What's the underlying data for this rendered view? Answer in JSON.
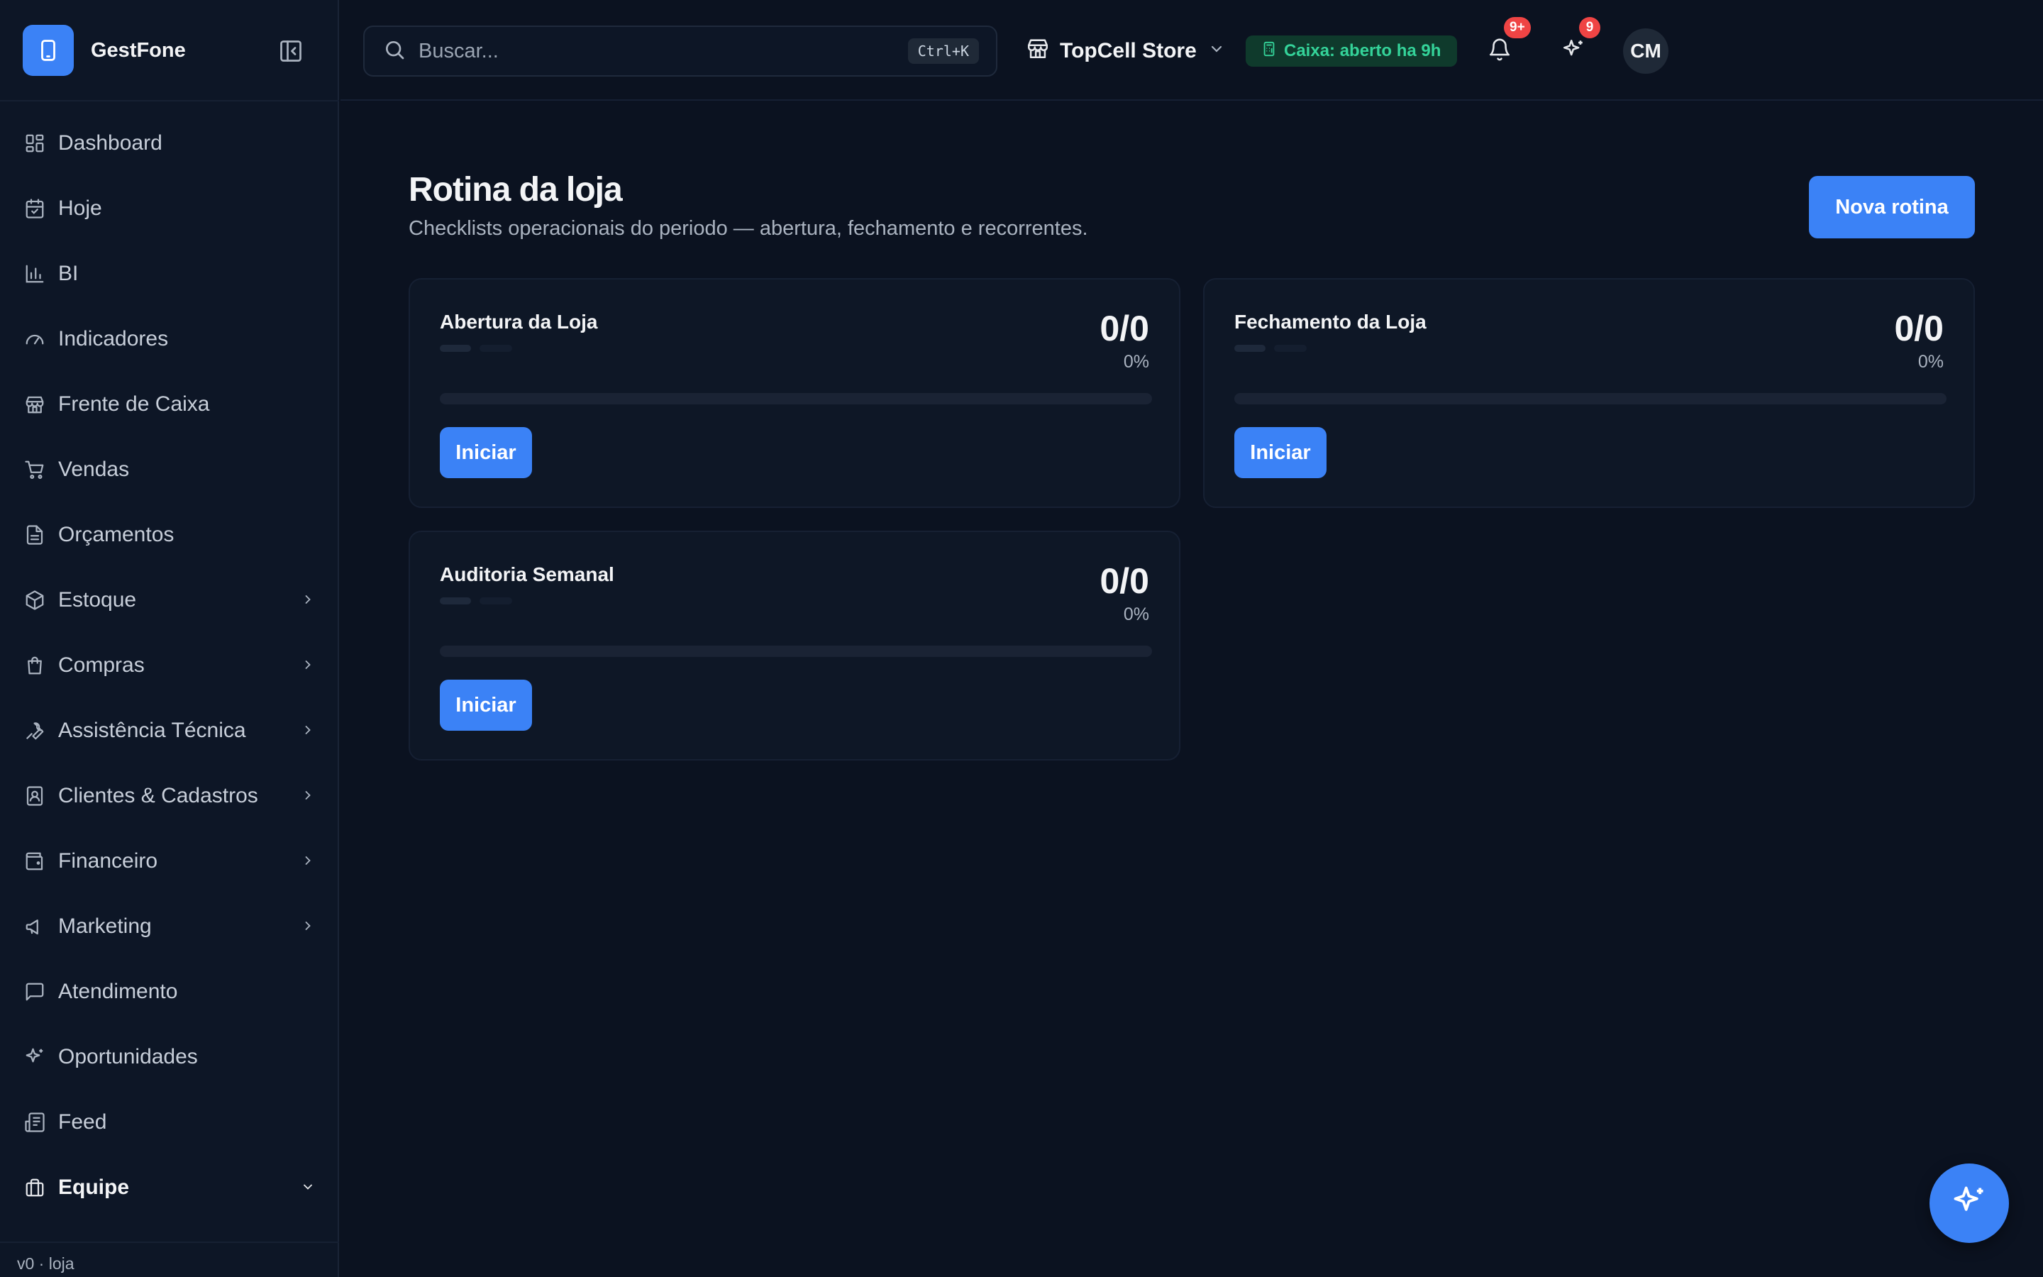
{
  "app": {
    "name": "GestFone",
    "version": "v0 · loja"
  },
  "colors": {
    "accent": "#3b82f6",
    "success": "#34d399",
    "badge": "#ef4444",
    "background": "#0b1220"
  },
  "sidebar": {
    "items": [
      {
        "label": "Dashboard",
        "icon": "dashboard-icon",
        "expandable": false
      },
      {
        "label": "Hoje",
        "icon": "calendar-icon",
        "expandable": false
      },
      {
        "label": "BI",
        "icon": "bar-chart-icon",
        "expandable": false
      },
      {
        "label": "Indicadores",
        "icon": "gauge-icon",
        "expandable": false
      },
      {
        "label": "Frente de Caixa",
        "icon": "store-icon",
        "expandable": false
      },
      {
        "label": "Vendas",
        "icon": "cart-icon",
        "expandable": false
      },
      {
        "label": "Orçamentos",
        "icon": "document-icon",
        "expandable": false
      },
      {
        "label": "Estoque",
        "icon": "package-icon",
        "expandable": true
      },
      {
        "label": "Compras",
        "icon": "shopping-bag-icon",
        "expandable": true
      },
      {
        "label": "Assistência Técnica",
        "icon": "wrench-icon",
        "expandable": true
      },
      {
        "label": "Clientes & Cadastros",
        "icon": "contact-icon",
        "expandable": true
      },
      {
        "label": "Financeiro",
        "icon": "wallet-icon",
        "expandable": true
      },
      {
        "label": "Marketing",
        "icon": "megaphone-icon",
        "expandable": true
      },
      {
        "label": "Atendimento",
        "icon": "message-icon",
        "expandable": false
      },
      {
        "label": "Oportunidades",
        "icon": "sparkles-icon",
        "expandable": false
      },
      {
        "label": "Feed",
        "icon": "newspaper-icon",
        "expandable": false
      },
      {
        "label": "Equipe",
        "icon": "briefcase-icon",
        "expandable": true,
        "expanded": true,
        "active": true
      }
    ]
  },
  "topbar": {
    "search_placeholder": "Buscar...",
    "search_shortcut": "Ctrl+K",
    "store_name": "TopCell Store",
    "cash_status": "Caixa: aberto ha 9h",
    "notifications_badge": "9+",
    "suggestions_badge": "9",
    "avatar_initials": "CM"
  },
  "main": {
    "title": "Rotina da loja",
    "subtitle": "Checklists operacionais do periodo — abertura, fechamento e recorrentes.",
    "new_button": "Nova rotina",
    "cards": [
      {
        "title": "Abertura da Loja",
        "count": "0/0",
        "percent": "0%",
        "progress": 0,
        "button": "Iniciar"
      },
      {
        "title": "Fechamento da Loja",
        "count": "0/0",
        "percent": "0%",
        "progress": 0,
        "button": "Iniciar"
      },
      {
        "title": "Auditoria Semanal",
        "count": "0/0",
        "percent": "0%",
        "progress": 0,
        "button": "Iniciar"
      }
    ]
  }
}
